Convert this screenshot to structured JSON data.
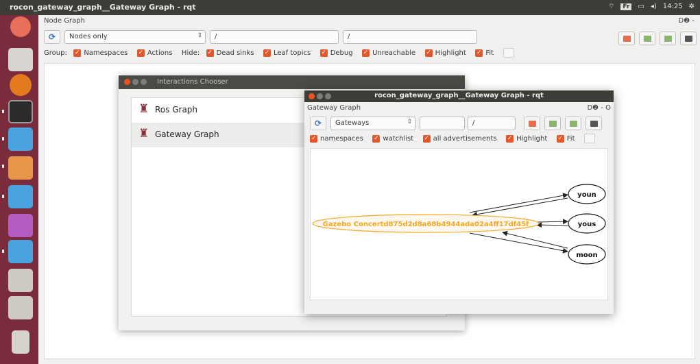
{
  "system": {
    "window_title": "rocon_gateway_graph__Gateway Graph - rqt",
    "keyboard": "Fr",
    "time": "14:25"
  },
  "main": {
    "window_name": "Node Graph",
    "window_right": "D❷ -",
    "mode_select": "Nodes only",
    "filter1": "/",
    "filter2": "/",
    "group_label": "Group:",
    "hide_label": "Hide:",
    "group_options": [
      "Namespaces",
      "Actions"
    ],
    "hide_options": [
      "Dead sinks",
      "Leaf topics",
      "Debug",
      "Unreachable"
    ],
    "extra_options": [
      "Highlight",
      "Fit"
    ]
  },
  "chooser": {
    "title": "Interactions Chooser",
    "items": [
      "Ros Graph",
      "Gateway Graph"
    ]
  },
  "gateway": {
    "title": "rocon_gateway_graph__Gateway Graph - rqt",
    "window_name": "Gateway Graph",
    "window_right": "D❷ - O",
    "mode_select": "Gateways",
    "filter1": "",
    "filter2": "/",
    "options": [
      "namespaces",
      "watchlist",
      "all advertisements"
    ],
    "extra_options": [
      "Highlight",
      "Fit"
    ],
    "graph": {
      "center_node": "Gazebo Concertd875d2d8a68b4944ada02a4ff17df45f",
      "nodes": [
        "youn",
        "yous",
        "moon"
      ],
      "center_color": "#f6a623"
    }
  },
  "colors": {
    "launcher": "#7a2c3c",
    "checkbox": "#e1572b",
    "panel": "#3d3c37"
  }
}
